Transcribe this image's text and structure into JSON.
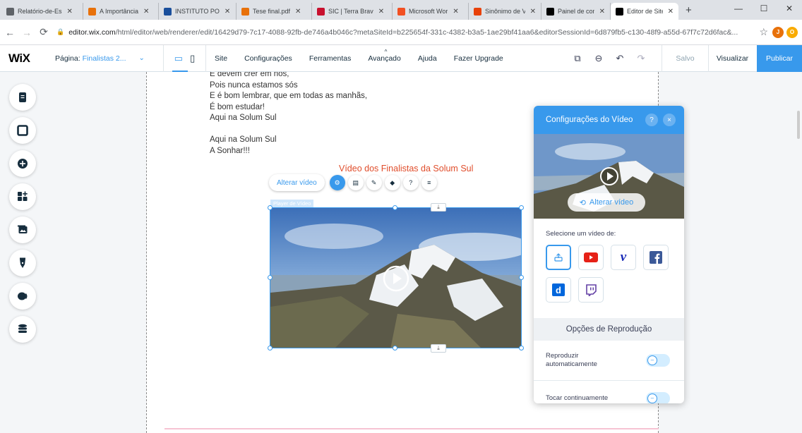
{
  "browser": {
    "tabs": [
      {
        "title": "Relatório-de-Es",
        "icon": "globe-icon",
        "color": "#5f6368"
      },
      {
        "title": "A Importância",
        "icon": "document-icon",
        "color": "#e8710a"
      },
      {
        "title": "INSTITUTO PO",
        "icon": "institute-icon",
        "color": "#1a4f9c"
      },
      {
        "title": "Tese final.pdf",
        "icon": "document-icon",
        "color": "#e8710a"
      },
      {
        "title": "SIC | Terra Brav",
        "icon": "sic-icon",
        "color": "#c8102e"
      },
      {
        "title": "Microsoft Wor",
        "icon": "microsoft-icon",
        "color": "#f25022"
      },
      {
        "title": "Sinônimo de Vi",
        "icon": "s-icon",
        "color": "#e8410a"
      },
      {
        "title": "Painel de contr",
        "icon": "wix-icon",
        "color": "#000000"
      },
      {
        "title": "Editor de Site",
        "icon": "wix-icon",
        "color": "#000000"
      }
    ],
    "new_tab": "+",
    "url_domain": "editor.wix.com",
    "url_path": "/html/editor/web/renderer/edit/16429d79-7c17-4088-92fb-de746a4b046c?metaSiteId=b225654f-331c-4382-b3a5-1ae29bf41aa6&editorSessionId=6d879fb5-c130-48f9-a55d-67f7c72d6fac&..."
  },
  "wix": {
    "logo": "WiX",
    "page_label": "Página:",
    "page_value": "Finalistas 2...",
    "menu": [
      "Site",
      "Configurações",
      "Ferramentas",
      "Avançado",
      "Ajuda",
      "Fazer Upgrade"
    ],
    "saved": "Salvo",
    "preview": "Visualizar",
    "publish": "Publicar"
  },
  "lyrics": [
    "E devem crer em nós,",
    "Pois nunca estamos sós",
    "E é bom lembrar, que em todas as manhãs,",
    "É bom estudar!",
    "Aqui na Solum Sul",
    "",
    "Aqui na Solum Sul",
    "A Sonhar!!!"
  ],
  "video": {
    "title": "Vídeo dos Finalistas da Solum Sul",
    "change_label": "Alterar vídeo",
    "tag": "Player de Vídeo"
  },
  "panel": {
    "title": "Configurações do Vídeo",
    "help": "?",
    "close": "×",
    "change_label": "Alterar vídeo",
    "select_label": "Selecione um vídeo de:",
    "sources": [
      "upload",
      "youtube",
      "vimeo",
      "facebook",
      "dailymotion",
      "twitch"
    ],
    "playback_title": "Opções de Reprodução",
    "autoplay_label": "Reproduzir automaticamente",
    "loop_label": "Tocar continuamente",
    "autoplay_on": false,
    "loop_on": false
  },
  "colors": {
    "wix_blue": "#3899ec",
    "title_red": "#e04d2b"
  }
}
